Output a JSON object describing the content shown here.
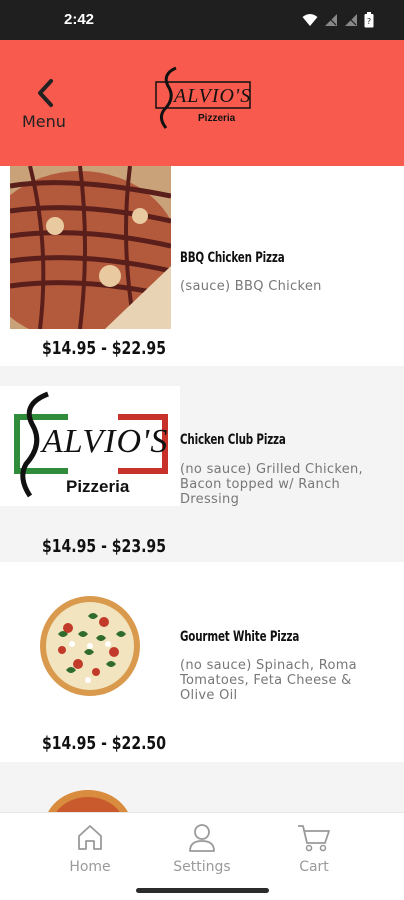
{
  "status_bar": {
    "time": "2:42"
  },
  "header": {
    "back_label": "Menu",
    "logo_text": "SALVIO'S",
    "logo_subtext": "Pizzeria",
    "background": "#f85a4d"
  },
  "menu_items": [
    {
      "name": "BBQ Chicken Pizza",
      "description": "(sauce) BBQ Chicken",
      "price": "$14.95 - $22.95",
      "image": "bbq-chicken-pizza-photo"
    },
    {
      "name": "Chicken Club Pizza",
      "description": "(no sauce) Grilled Chicken, Bacon topped w/ Ranch Dressing",
      "price": "$14.95 - $23.95",
      "image": "salvios-logo"
    },
    {
      "name": "Gourmet White Pizza",
      "description": "(no sauce) Spinach, Roma Tomatoes, Feta Cheese & Olive Oil",
      "price": "$14.95 - $22.50",
      "image": "white-pizza-photo"
    }
  ],
  "bottom_nav": [
    {
      "label": "Home",
      "icon": "home-icon"
    },
    {
      "label": "Settings",
      "icon": "user-icon"
    },
    {
      "label": "Cart",
      "icon": "cart-icon"
    }
  ],
  "colors": {
    "header": "#f85a4d",
    "alt_row": "#f4f4f4",
    "nav_label": "#9a9a9a"
  }
}
